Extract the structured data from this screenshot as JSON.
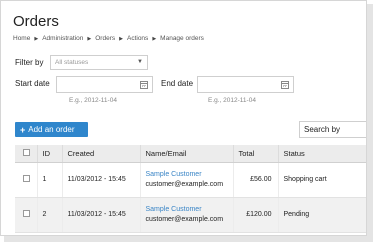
{
  "header": {
    "title": "Orders",
    "breadcrumb": [
      "Home",
      "Administration",
      "Orders",
      "Actions",
      "Manage orders"
    ]
  },
  "filters": {
    "filter_label": "Filter by",
    "status_value": "All statuses",
    "start_label": "Start date",
    "start_hint": "E.g., 2012-11-04",
    "end_label": "End date",
    "end_hint": "E.g., 2012-11-04"
  },
  "actions": {
    "add_order": "Add an order",
    "search_by": "Search by"
  },
  "table": {
    "columns": [
      "ID",
      "Created",
      "Name/Email",
      "Total",
      "Status"
    ],
    "rows": [
      {
        "id": "1",
        "created": "11/03/2012 - 15:45",
        "name": "Sample Customer",
        "email": "customer@example.com",
        "total": "£56.00",
        "status": "Shopping cart"
      },
      {
        "id": "2",
        "created": "11/03/2012 - 15:45",
        "name": "Sample Customer",
        "email": "customer@example.com",
        "total": "£120.00",
        "status": "Pending"
      }
    ]
  },
  "colors": {
    "accent": "#2f86cc",
    "link": "#3a85c6"
  }
}
